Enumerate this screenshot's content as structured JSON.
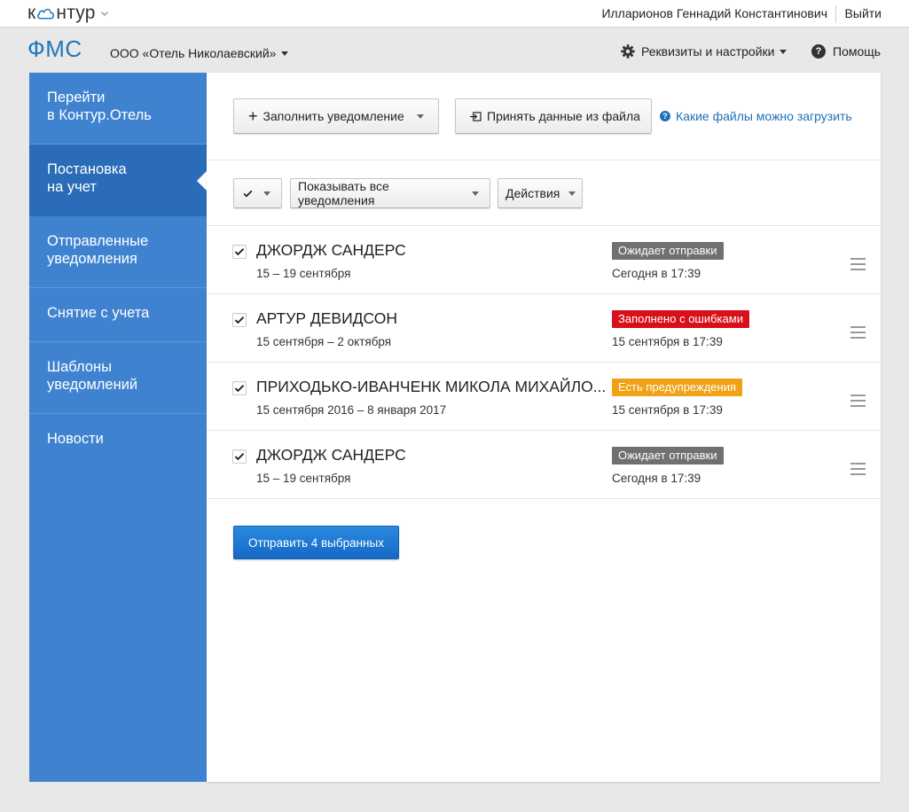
{
  "topbar": {
    "logo_prefix": "к",
    "logo_suffix": "нтур",
    "user_name": "Илларионов Геннадий Константинович",
    "logout_label": "Выйти"
  },
  "header": {
    "brand": "ФМС",
    "organization": "ООО «Отель Николаевский»",
    "settings_label": "Реквизиты и настройки",
    "help_label": "Помощь"
  },
  "sidebar": {
    "items": [
      {
        "line1": "Перейти",
        "line2": "в Контур.Отель"
      },
      {
        "line1": "Постановка",
        "line2": "на учет"
      },
      {
        "line1": "Отправленные",
        "line2": "уведомления"
      },
      {
        "line1": "Снятие с учета",
        "line2": ""
      },
      {
        "line1": "Шаблоны",
        "line2": "уведомлений"
      },
      {
        "line1": "Новости",
        "line2": ""
      }
    ]
  },
  "toolbar": {
    "fill_label": "Заполнить уведомление",
    "import_label": "Принять данные из файла",
    "help_link": "Какие файлы можно загрузить",
    "filter_label": "Показывать все уведомления",
    "actions_label": "Действия"
  },
  "colors": {
    "accent": "#3f83d0",
    "status_waiting": "#707070",
    "status_errors": "#d8101c",
    "status_warnings": "#f0a116"
  },
  "notifications": [
    {
      "name": "ДЖОРДЖ САНДЕРС",
      "dates": "15 – 19 сентября",
      "status": "Ожидает отправки",
      "status_color": "#707070",
      "time": "Сегодня в 17:39",
      "checked": true
    },
    {
      "name": "АРТУР ДЕВИДСОН",
      "dates": "15 сентября – 2 октября",
      "status": "Заполнено с ошибками",
      "status_color": "#d8101c",
      "time": "15 сентября в 17:39",
      "checked": true
    },
    {
      "name": "ПРИХОДЬКО-ИВАНЧЕНК МИКОЛА МИХАЙЛО...",
      "dates": "15 сентября 2016 – 8 января 2017",
      "status": "Есть предупреждения",
      "status_color": "#f0a116",
      "time": "15 сентября в 17:39",
      "checked": true
    },
    {
      "name": "ДЖОРДЖ САНДЕРС",
      "dates": "15 – 19 сентября",
      "status": "Ожидает отправки",
      "status_color": "#707070",
      "time": "Сегодня в 17:39",
      "checked": true
    }
  ],
  "send_button_label": "Отправить 4 выбранных"
}
